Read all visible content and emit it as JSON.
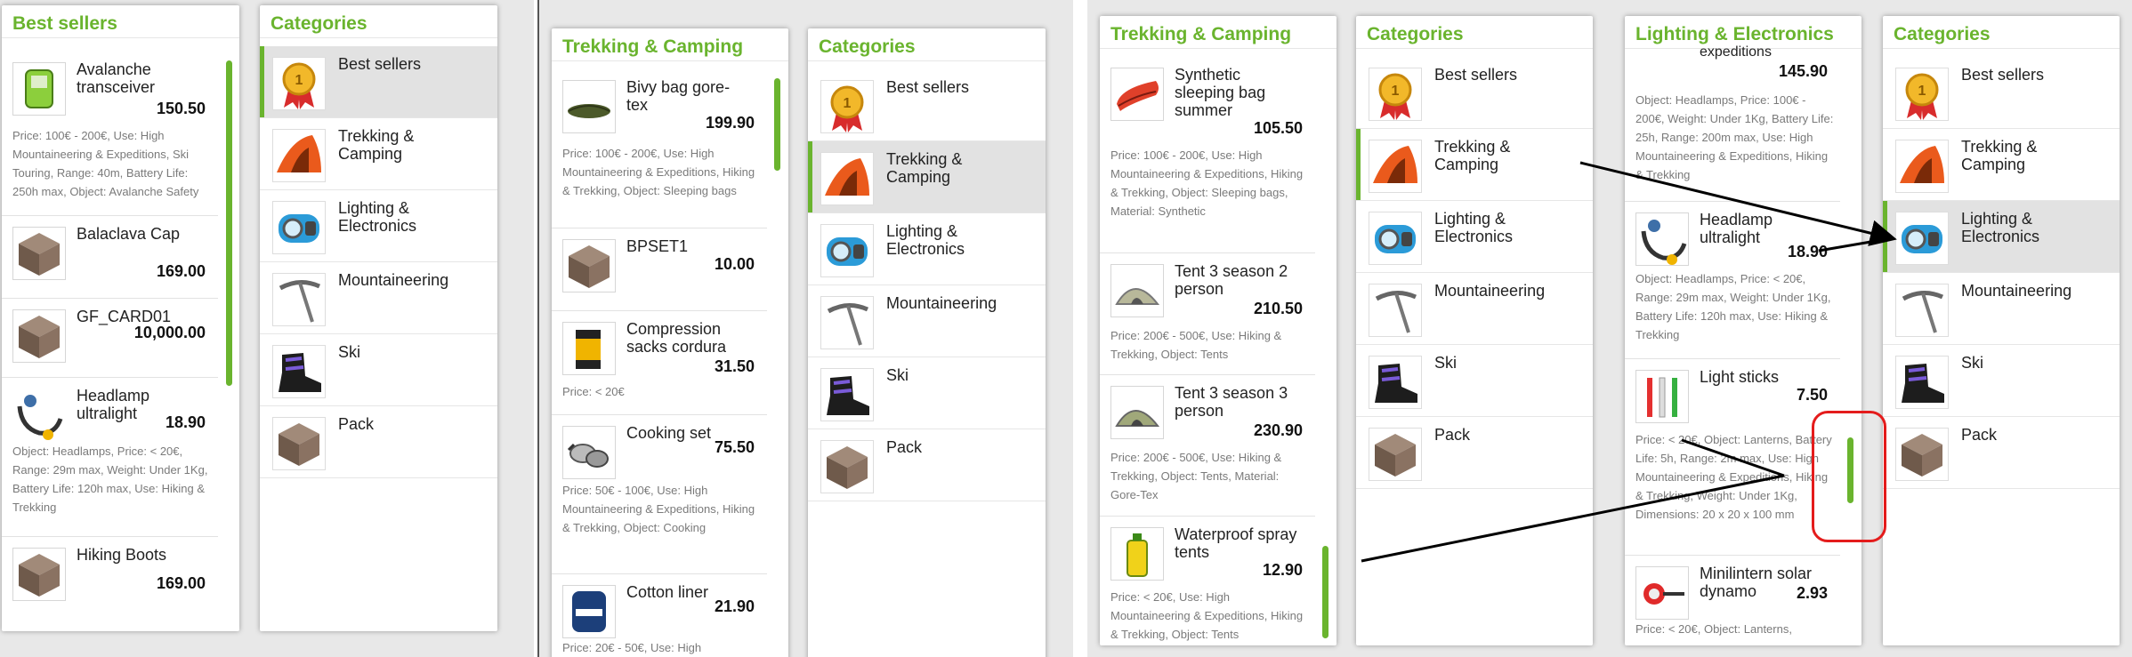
{
  "screenshot1": {
    "best_sellers": {
      "title": "Best sellers",
      "items": [
        {
          "name": "Avalanche transceiver",
          "price": "150.50",
          "desc": "Price: 100€ - 200€, Use: High Mountaineering & Expeditions, Ski Touring, Range: 40m, Battery Life: 250h max, Object: Avalanche Safety",
          "icon": "avalanche-transceiver-icon"
        },
        {
          "name": "Balaclava Cap",
          "price": "169.00",
          "desc": "",
          "icon": "box-icon"
        },
        {
          "name": "GF_CARD01",
          "price": "10,000.00",
          "desc": "",
          "icon": "box-icon"
        },
        {
          "name": "Headlamp ultralight",
          "price": "18.90",
          "desc": "Object: Headlamps, Price: < 20€, Range: 29m max, Weight: Under 1Kg, Battery Life: 120h max, Use: Hiking & Trekking",
          "icon": "headlamp-icon"
        },
        {
          "name": "Hiking Boots",
          "price": "169.00",
          "desc": "",
          "icon": "box-icon"
        }
      ]
    },
    "categories": {
      "title": "Categories",
      "selected": 0
    }
  },
  "screenshot2": {
    "trekking": {
      "title": "Trekking & Camping",
      "items": [
        {
          "name": "Bivy bag gore-tex",
          "price": "199.90",
          "desc": "Price: 100€ - 200€, Use: High Mountaineering & Expeditions, Hiking & Trekking, Object: Sleeping bags",
          "icon": "bivy-bag-icon"
        },
        {
          "name": "BPSET1",
          "price": "10.00",
          "desc": "",
          "icon": "box-icon"
        },
        {
          "name": "Compression sacks cordura",
          "price": "31.50",
          "desc": "Price: < 20€",
          "icon": "compression-sack-icon"
        },
        {
          "name": "Cooking set",
          "price": "75.50",
          "desc": "Price: 50€ - 100€, Use: High Mountaineering & Expeditions, Hiking & Trekking, Object: Cooking",
          "icon": "cooking-set-icon"
        },
        {
          "name": "Cotton liner",
          "price": "21.90",
          "desc": "Price: 20€ - 50€, Use: High",
          "icon": "cotton-liner-icon"
        }
      ]
    },
    "categories": {
      "title": "Categories",
      "selected": 1
    }
  },
  "screenshot3": {
    "trekking": {
      "title": "Trekking & Camping",
      "items": [
        {
          "name": "Synthetic sleeping bag summer",
          "price": "105.50",
          "desc": "Price: 100€ - 200€, Use: High Mountaineering & Expeditions, Hiking & Trekking, Object: Sleeping bags, Material: Synthetic",
          "icon": "sleeping-bag-icon"
        },
        {
          "name": "Tent 3 season 2 person",
          "price": "210.50",
          "desc": "Price: 200€ - 500€, Use: Hiking & Trekking, Object: Tents",
          "icon": "tent-icon"
        },
        {
          "name": "Tent 3 season 3 person",
          "price": "230.90",
          "desc": "Price: 200€ - 500€, Use: Hiking & Trekking, Object: Tents, Material: Gore-Tex",
          "icon": "tent-icon"
        },
        {
          "name": "Waterproof spray tents",
          "price": "12.90",
          "desc": "Price: < 20€, Use: High Mountaineering & Expeditions, Hiking & Trekking, Object: Tents",
          "icon": "spray-can-icon"
        }
      ]
    },
    "categories": {
      "title": "Categories",
      "selected": 1
    }
  },
  "screenshot4": {
    "lighting": {
      "title": "Lighting & Electronics",
      "partial_name": "expeditions",
      "partial_price": "145.90",
      "partial_desc": "Object: Headlamps, Price: 100€ - 200€, Weight: Under 1Kg, Battery Life: 25h, Range: 200m max, Use: High Mountaineering & Expeditions, Hiking & Trekking",
      "items": [
        {
          "name": "Headlamp ultralight",
          "price": "18.90",
          "desc": "Object: Headlamps, Price: < 20€, Range: 29m max, Weight: Under 1Kg, Battery Life: 120h max, Use: Hiking & Trekking",
          "icon": "headlamp-icon"
        },
        {
          "name": "Light sticks",
          "price": "7.50",
          "desc": "Price: < 20€, Object: Lanterns, Battery Life: 5h, Range: 2m max, Use: High Mountaineering & Expeditions, Hiking & Trekking, Weight: Under 1Kg, Dimensions: 20 x 20 x 100 mm",
          "icon": "light-sticks-icon"
        },
        {
          "name": "Minilintern solar dynamo",
          "price": "2.93",
          "desc": "Price: < 20€, Object: Lanterns,",
          "icon": "lantern-icon"
        }
      ]
    },
    "categories": {
      "title": "Categories",
      "selected": 2
    }
  },
  "category_items": [
    {
      "label": "Best sellers",
      "icon": "medal-icon"
    },
    {
      "label": "Trekking & Camping",
      "icon": "tent-icon"
    },
    {
      "label": "Lighting & Electronics",
      "icon": "headlamp-icon"
    },
    {
      "label": "Mountaineering",
      "icon": "ice-axe-icon"
    },
    {
      "label": "Ski",
      "icon": "ski-boot-icon"
    },
    {
      "label": "Pack",
      "icon": "box-icon"
    }
  ],
  "colors": {
    "accent": "#6ab42e",
    "selected_bg": "#e2e2e2",
    "annotation": "#e41c1c"
  }
}
